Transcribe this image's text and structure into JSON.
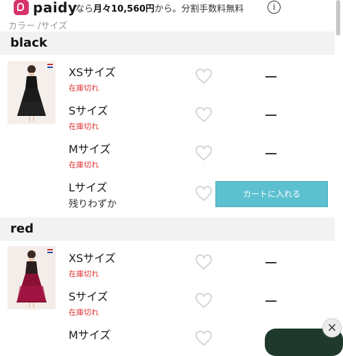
{
  "paidy": {
    "logo_text": "paidy",
    "promo_prefix": "なら",
    "promo_amount": "月々10,560円",
    "promo_suffix": "から。分割手数料無料",
    "info_icon": "i"
  },
  "section_label": "カラー /サイズ",
  "groups": [
    {
      "color": "black",
      "sizes": [
        {
          "size": "XSサイズ",
          "stock": "在庫切れ",
          "status": "—"
        },
        {
          "size": "Sサイズ",
          "stock": "在庫切れ",
          "status": "—"
        },
        {
          "size": "Mサイズ",
          "stock": "在庫切れ",
          "status": "—"
        },
        {
          "size": "Lサイズ",
          "stock": "残りわずか",
          "cart_label": "カートに入れる"
        }
      ]
    },
    {
      "color": "red",
      "sizes": [
        {
          "size": "XSサイズ",
          "stock": "在庫切れ",
          "status": "—"
        },
        {
          "size": "Sサイズ",
          "stock": "在庫切れ",
          "status": "—"
        },
        {
          "size": "Mサイズ",
          "stock": "",
          "status": ""
        }
      ]
    }
  ],
  "close_icon": "×",
  "colors": {
    "cart_button": "#5cc0cf",
    "out_of_stock": "#e03131",
    "paidy_brand": "#d6336c",
    "header_bg": "#f2f2f2"
  }
}
